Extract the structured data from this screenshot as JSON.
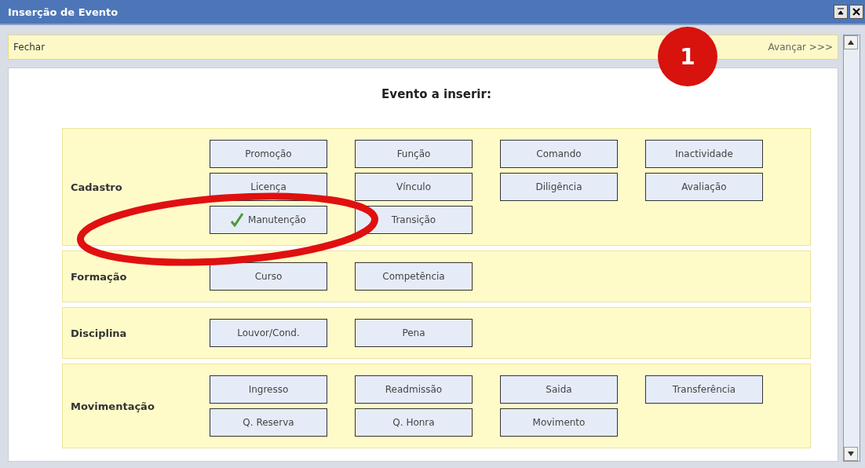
{
  "window": {
    "title": "Inserção de Evento"
  },
  "toolbar": {
    "close": "Fechar",
    "next": "Avançar >>>"
  },
  "heading": "Evento a inserir:",
  "step_badge": "1",
  "sections": [
    {
      "label": "Cadastro",
      "buttons": [
        {
          "label": "Promoção",
          "checked": false
        },
        {
          "label": "Função",
          "checked": false
        },
        {
          "label": "Comando",
          "checked": false
        },
        {
          "label": "Inactividade",
          "checked": false
        },
        {
          "label": "Licença",
          "checked": false
        },
        {
          "label": "Vínculo",
          "checked": false
        },
        {
          "label": "Diligência",
          "checked": false
        },
        {
          "label": "Avaliação",
          "checked": false
        },
        {
          "label": "Manutenção",
          "checked": true
        },
        {
          "label": "Transição",
          "checked": false
        }
      ]
    },
    {
      "label": "Formação",
      "buttons": [
        {
          "label": "Curso",
          "checked": false
        },
        {
          "label": "Competência",
          "checked": false
        }
      ]
    },
    {
      "label": "Disciplina",
      "buttons": [
        {
          "label": "Louvor/Cond.",
          "checked": false
        },
        {
          "label": "Pena",
          "checked": false
        }
      ]
    },
    {
      "label": "Movimentação",
      "buttons": [
        {
          "label": "Ingresso",
          "checked": false
        },
        {
          "label": "Readmissão",
          "checked": false
        },
        {
          "label": "Saida",
          "checked": false
        },
        {
          "label": "Transferência",
          "checked": false
        },
        {
          "label": "Q. Reserva",
          "checked": false
        },
        {
          "label": "Q. Honra",
          "checked": false
        },
        {
          "label": "Movimento",
          "checked": false
        }
      ]
    }
  ]
}
